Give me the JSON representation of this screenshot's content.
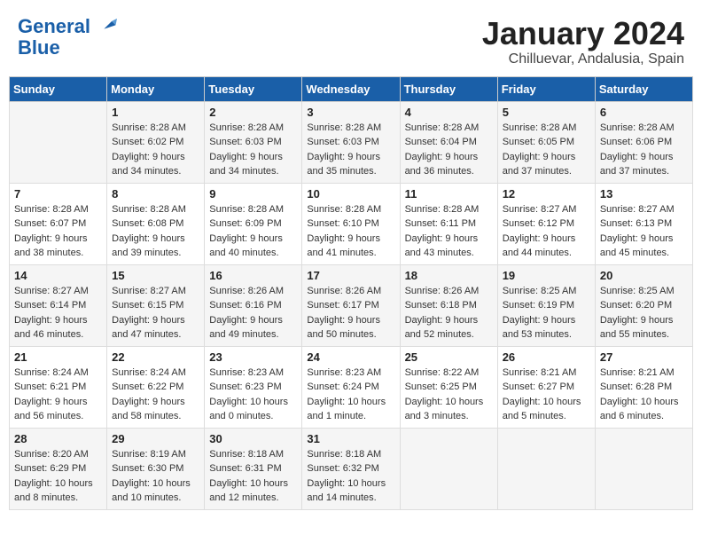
{
  "logo": {
    "line1": "General",
    "line2": "Blue"
  },
  "title": "January 2024",
  "subtitle": "Chilluevar, Andalusia, Spain",
  "weekdays": [
    "Sunday",
    "Monday",
    "Tuesday",
    "Wednesday",
    "Thursday",
    "Friday",
    "Saturday"
  ],
  "weeks": [
    [
      {
        "day": "",
        "info": ""
      },
      {
        "day": "1",
        "info": "Sunrise: 8:28 AM\nSunset: 6:02 PM\nDaylight: 9 hours\nand 34 minutes."
      },
      {
        "day": "2",
        "info": "Sunrise: 8:28 AM\nSunset: 6:03 PM\nDaylight: 9 hours\nand 34 minutes."
      },
      {
        "day": "3",
        "info": "Sunrise: 8:28 AM\nSunset: 6:03 PM\nDaylight: 9 hours\nand 35 minutes."
      },
      {
        "day": "4",
        "info": "Sunrise: 8:28 AM\nSunset: 6:04 PM\nDaylight: 9 hours\nand 36 minutes."
      },
      {
        "day": "5",
        "info": "Sunrise: 8:28 AM\nSunset: 6:05 PM\nDaylight: 9 hours\nand 37 minutes."
      },
      {
        "day": "6",
        "info": "Sunrise: 8:28 AM\nSunset: 6:06 PM\nDaylight: 9 hours\nand 37 minutes."
      }
    ],
    [
      {
        "day": "7",
        "info": "Sunrise: 8:28 AM\nSunset: 6:07 PM\nDaylight: 9 hours\nand 38 minutes."
      },
      {
        "day": "8",
        "info": "Sunrise: 8:28 AM\nSunset: 6:08 PM\nDaylight: 9 hours\nand 39 minutes."
      },
      {
        "day": "9",
        "info": "Sunrise: 8:28 AM\nSunset: 6:09 PM\nDaylight: 9 hours\nand 40 minutes."
      },
      {
        "day": "10",
        "info": "Sunrise: 8:28 AM\nSunset: 6:10 PM\nDaylight: 9 hours\nand 41 minutes."
      },
      {
        "day": "11",
        "info": "Sunrise: 8:28 AM\nSunset: 6:11 PM\nDaylight: 9 hours\nand 43 minutes."
      },
      {
        "day": "12",
        "info": "Sunrise: 8:27 AM\nSunset: 6:12 PM\nDaylight: 9 hours\nand 44 minutes."
      },
      {
        "day": "13",
        "info": "Sunrise: 8:27 AM\nSunset: 6:13 PM\nDaylight: 9 hours\nand 45 minutes."
      }
    ],
    [
      {
        "day": "14",
        "info": "Sunrise: 8:27 AM\nSunset: 6:14 PM\nDaylight: 9 hours\nand 46 minutes."
      },
      {
        "day": "15",
        "info": "Sunrise: 8:27 AM\nSunset: 6:15 PM\nDaylight: 9 hours\nand 47 minutes."
      },
      {
        "day": "16",
        "info": "Sunrise: 8:26 AM\nSunset: 6:16 PM\nDaylight: 9 hours\nand 49 minutes."
      },
      {
        "day": "17",
        "info": "Sunrise: 8:26 AM\nSunset: 6:17 PM\nDaylight: 9 hours\nand 50 minutes."
      },
      {
        "day": "18",
        "info": "Sunrise: 8:26 AM\nSunset: 6:18 PM\nDaylight: 9 hours\nand 52 minutes."
      },
      {
        "day": "19",
        "info": "Sunrise: 8:25 AM\nSunset: 6:19 PM\nDaylight: 9 hours\nand 53 minutes."
      },
      {
        "day": "20",
        "info": "Sunrise: 8:25 AM\nSunset: 6:20 PM\nDaylight: 9 hours\nand 55 minutes."
      }
    ],
    [
      {
        "day": "21",
        "info": "Sunrise: 8:24 AM\nSunset: 6:21 PM\nDaylight: 9 hours\nand 56 minutes."
      },
      {
        "day": "22",
        "info": "Sunrise: 8:24 AM\nSunset: 6:22 PM\nDaylight: 9 hours\nand 58 minutes."
      },
      {
        "day": "23",
        "info": "Sunrise: 8:23 AM\nSunset: 6:23 PM\nDaylight: 10 hours\nand 0 minutes."
      },
      {
        "day": "24",
        "info": "Sunrise: 8:23 AM\nSunset: 6:24 PM\nDaylight: 10 hours\nand 1 minute."
      },
      {
        "day": "25",
        "info": "Sunrise: 8:22 AM\nSunset: 6:25 PM\nDaylight: 10 hours\nand 3 minutes."
      },
      {
        "day": "26",
        "info": "Sunrise: 8:21 AM\nSunset: 6:27 PM\nDaylight: 10 hours\nand 5 minutes."
      },
      {
        "day": "27",
        "info": "Sunrise: 8:21 AM\nSunset: 6:28 PM\nDaylight: 10 hours\nand 6 minutes."
      }
    ],
    [
      {
        "day": "28",
        "info": "Sunrise: 8:20 AM\nSunset: 6:29 PM\nDaylight: 10 hours\nand 8 minutes."
      },
      {
        "day": "29",
        "info": "Sunrise: 8:19 AM\nSunset: 6:30 PM\nDaylight: 10 hours\nand 10 minutes."
      },
      {
        "day": "30",
        "info": "Sunrise: 8:18 AM\nSunset: 6:31 PM\nDaylight: 10 hours\nand 12 minutes."
      },
      {
        "day": "31",
        "info": "Sunrise: 8:18 AM\nSunset: 6:32 PM\nDaylight: 10 hours\nand 14 minutes."
      },
      {
        "day": "",
        "info": ""
      },
      {
        "day": "",
        "info": ""
      },
      {
        "day": "",
        "info": ""
      }
    ]
  ]
}
